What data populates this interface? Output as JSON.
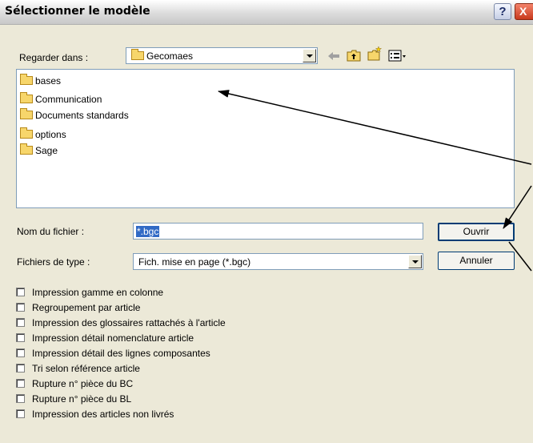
{
  "window": {
    "title": "Sélectionner le modèle",
    "help_label": "?",
    "close_label": "X"
  },
  "look_in": {
    "label": "Regarder dans :",
    "value": "Gecomaes"
  },
  "toolbar": {
    "back_icon": "back-arrow-icon",
    "up_icon": "up-folder-icon",
    "new_folder_icon": "new-folder-icon",
    "view_icon": "view-menu-icon"
  },
  "files": [
    {
      "name": "bases"
    },
    {
      "name": "Communication"
    },
    {
      "name": "Documents standards"
    },
    {
      "name": "options"
    },
    {
      "name": "Sage"
    }
  ],
  "filename": {
    "label": "Nom du fichier :",
    "value": "*.bgc"
  },
  "filetype": {
    "label": "Fichiers de type :",
    "value": "Fich. mise en page (*.bgc)"
  },
  "buttons": {
    "open": "Ouvrir",
    "cancel": "Annuler"
  },
  "options": [
    {
      "label": "Impression gamme en colonne",
      "checked": false
    },
    {
      "label": "Regroupement par article",
      "checked": false
    },
    {
      "label": "Impression des glossaires rattachés à l'article",
      "checked": false
    },
    {
      "label": "Impression détail nomenclature article",
      "checked": false
    },
    {
      "label": "Impression détail des lignes composantes",
      "checked": false
    },
    {
      "label": "Tri selon référence article",
      "checked": false
    },
    {
      "label": "Rupture n° pièce du BC",
      "checked": false
    },
    {
      "label": "Rupture n° pièce du BL",
      "checked": false
    },
    {
      "label": "Impression des articles non livrés",
      "checked": false
    }
  ],
  "colors": {
    "selection": "#316ac5",
    "arrow": "#000000",
    "dialog_bg": "#ece9d8"
  }
}
